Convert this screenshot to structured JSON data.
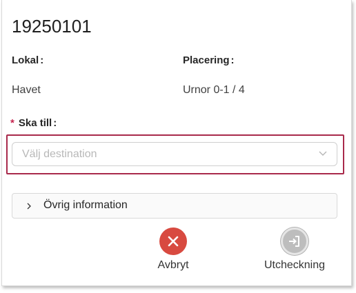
{
  "header": {
    "title": "19250101"
  },
  "fields": {
    "lokal": {
      "label": "Lokal",
      "value": "Havet"
    },
    "placering": {
      "label": "Placering",
      "value": "Urnor 0-1 / 4"
    }
  },
  "destination": {
    "required_mark": "*",
    "label": "Ska till",
    "placeholder": "Välj destination"
  },
  "more_info": {
    "label": "Övrig information"
  },
  "actions": {
    "cancel": {
      "label": "Avbryt",
      "icon": "close-icon",
      "color": "#d84a40"
    },
    "checkout": {
      "label": "Utcheckning",
      "icon": "sign-in-icon",
      "color": "#bdbdbd"
    }
  },
  "colors": {
    "error_border": "#a8294a",
    "required": "#c5254f"
  }
}
